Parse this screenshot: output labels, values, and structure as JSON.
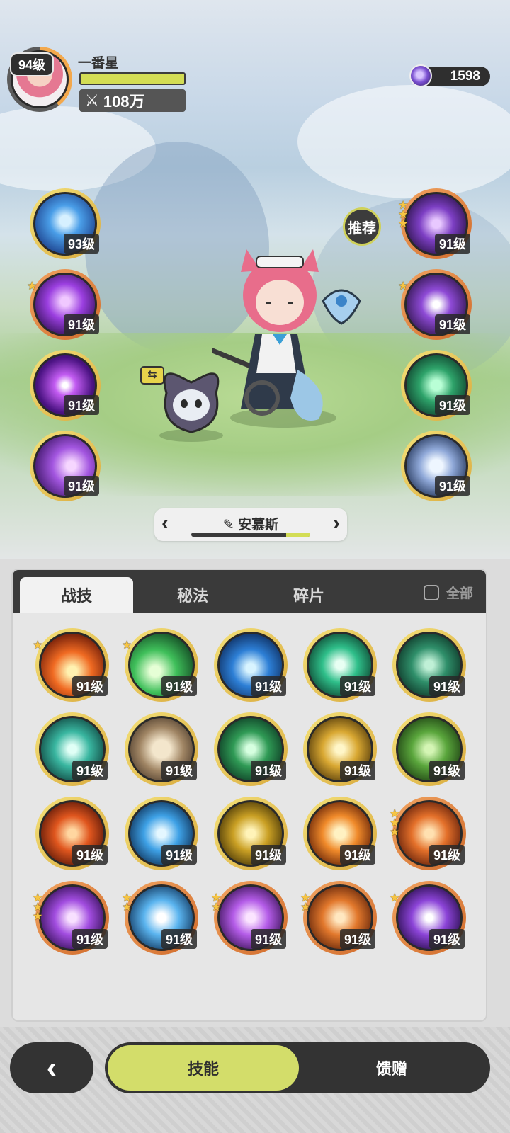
{
  "player": {
    "name": "一番星",
    "level": "94级",
    "power": "108万",
    "hp_fill": 1.0
  },
  "currency": {
    "value": "1598",
    "icon": "purple-crystal-icon"
  },
  "recommend_label": "推荐",
  "left_skills": [
    {
      "level": "93级",
      "icon": "blue-shield-icon",
      "stars": 0,
      "ring": "gold"
    },
    {
      "level": "91级",
      "icon": "purple-hand-icon",
      "stars": 1,
      "ring": "orange"
    },
    {
      "level": "91级",
      "icon": "purple-eye-icon",
      "stars": 0,
      "ring": "gold"
    },
    {
      "level": "91级",
      "icon": "purple-vortex-icon",
      "stars": 0,
      "ring": "gold"
    }
  ],
  "right_skills": [
    {
      "level": "91级",
      "icon": "purple-sigil-icon",
      "stars": 3,
      "ring": "orange"
    },
    {
      "level": "91级",
      "icon": "purple-eye-sigil-icon",
      "stars": 1,
      "ring": "orange"
    },
    {
      "level": "91级",
      "icon": "green-heart-icon",
      "stars": 0,
      "ring": "gold"
    },
    {
      "level": "91级",
      "icon": "blue-orb-icon",
      "stars": 0,
      "ring": "gold"
    }
  ],
  "selector": {
    "name": "安慕斯",
    "progress": 0.2
  },
  "tabs": [
    {
      "label": "战技",
      "active": true
    },
    {
      "label": "秘法",
      "active": false
    },
    {
      "label": "碎片",
      "active": false
    }
  ],
  "all_label": "全部",
  "grid_skills": [
    {
      "level": "91级",
      "icon": "fire-burst-icon",
      "stars": 1,
      "ring": "gold"
    },
    {
      "level": "91级",
      "icon": "green-comet-icon",
      "stars": 1,
      "ring": "gold"
    },
    {
      "level": "91级",
      "icon": "blue-water-icon",
      "stars": 0,
      "ring": "gold"
    },
    {
      "level": "91级",
      "icon": "green-wind-icon",
      "stars": 0,
      "ring": "gold"
    },
    {
      "level": "91级",
      "icon": "green-thorn-icon",
      "stars": 0,
      "ring": "gold"
    },
    {
      "level": "91级",
      "icon": "teal-swirl-icon",
      "stars": 0,
      "ring": "gold"
    },
    {
      "level": "91级",
      "icon": "card-fan-icon",
      "stars": 0,
      "ring": "gold"
    },
    {
      "level": "91级",
      "icon": "green-heal-icon",
      "stars": 0,
      "ring": "gold"
    },
    {
      "level": "91级",
      "icon": "gold-sparkle-icon",
      "stars": 0,
      "ring": "gold"
    },
    {
      "level": "91级",
      "icon": "green-scroll-icon",
      "stars": 0,
      "ring": "gold"
    },
    {
      "level": "91级",
      "icon": "fire-swirl-icon",
      "stars": 0,
      "ring": "gold"
    },
    {
      "level": "91级",
      "icon": "ice-crystal-icon",
      "stars": 0,
      "ring": "gold"
    },
    {
      "level": "91级",
      "icon": "gold-crystal-icon",
      "stars": 0,
      "ring": "gold"
    },
    {
      "level": "91级",
      "icon": "fire-orb-icon",
      "stars": 0,
      "ring": "gold"
    },
    {
      "level": "91级",
      "icon": "fire-dragon-icon",
      "stars": 3,
      "ring": "orange"
    },
    {
      "level": "91级",
      "icon": "purple-card-icon",
      "stars": 3,
      "ring": "orange"
    },
    {
      "level": "91级",
      "icon": "ice-shatter-icon",
      "stars": 2,
      "ring": "orange"
    },
    {
      "level": "91级",
      "icon": "purple-star-burst-icon",
      "stars": 2,
      "ring": "orange"
    },
    {
      "level": "91级",
      "icon": "fire-golem-icon",
      "stars": 2,
      "ring": "orange"
    },
    {
      "level": "91级",
      "icon": "purple-star-icon",
      "stars": 1,
      "ring": "orange"
    }
  ],
  "bottom": {
    "skills_label": "技能",
    "gift_label": "馈赠"
  },
  "colors": {
    "accent": "#d3dd6a",
    "dark": "#333333",
    "star": "#f7c543"
  }
}
